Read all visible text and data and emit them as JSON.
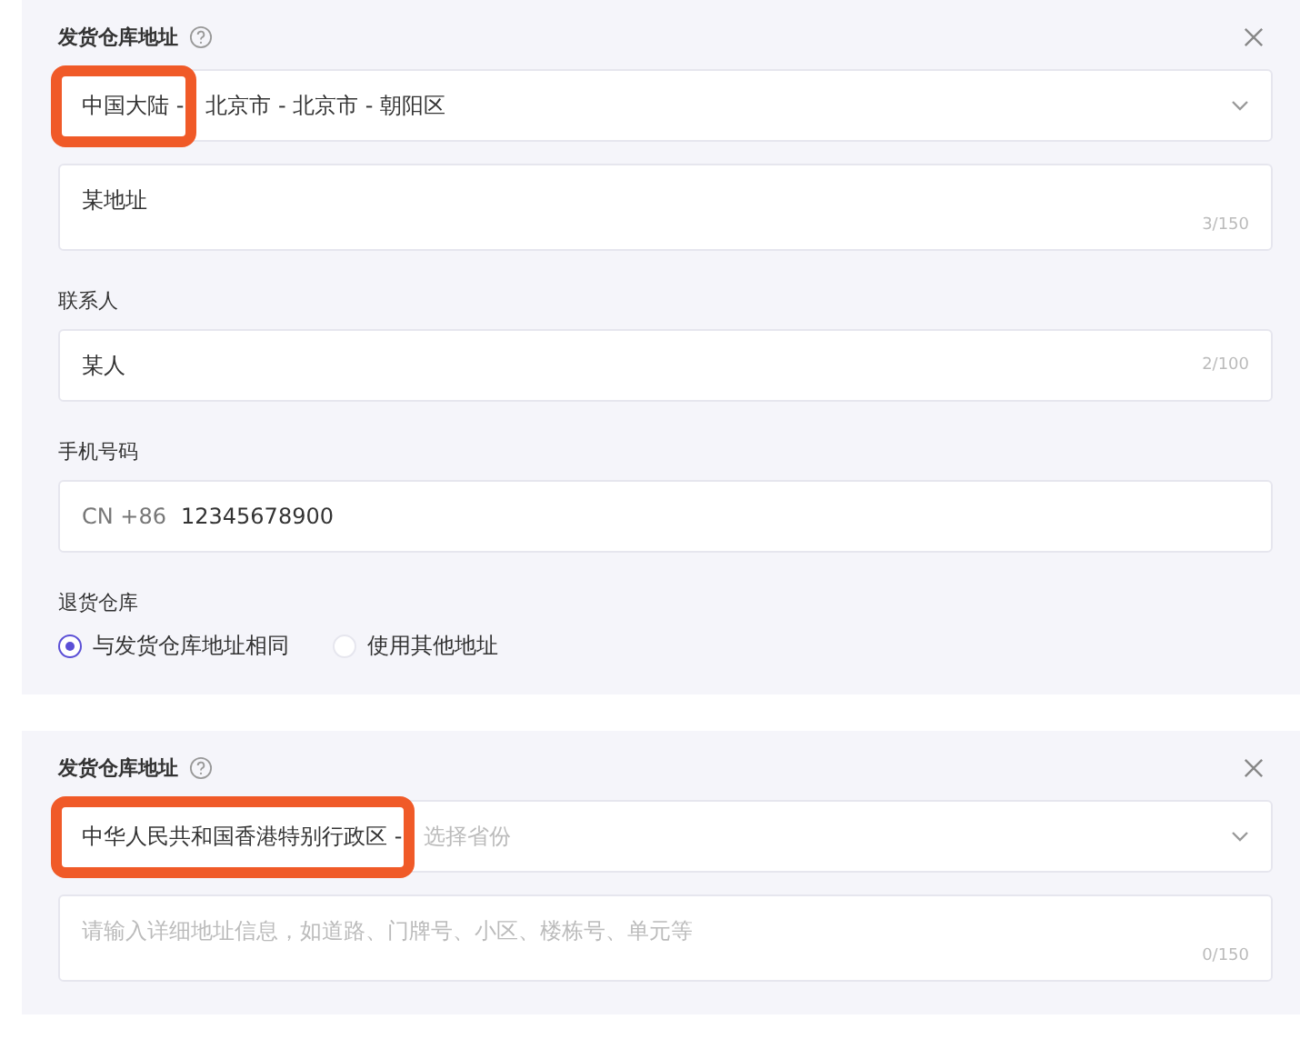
{
  "cards": [
    {
      "title": "发货仓库地址",
      "region": {
        "parts": [
          {
            "text": "中国大陆 -",
            "highlighted": true
          },
          {
            "text": "北京市 - 北京市 - 朝阳区",
            "highlighted": false
          }
        ]
      },
      "address": {
        "value": "某地址",
        "count": "3/150"
      },
      "contact": {
        "label": "联系人",
        "value": "某人",
        "count": "2/100"
      },
      "phone": {
        "label": "手机号码",
        "prefix": "CN +86",
        "value": "12345678900"
      },
      "return": {
        "label": "退货仓库",
        "options": [
          {
            "label": "与发货仓库地址相同",
            "selected": true
          },
          {
            "label": "使用其他地址",
            "selected": false
          }
        ]
      }
    },
    {
      "title": "发货仓库地址",
      "region": {
        "parts": [
          {
            "text": "中华人民共和国香港特别行政区 -",
            "highlighted": true
          }
        ],
        "placeholder": "选择省份"
      },
      "address": {
        "placeholder": "请输入详细地址信息，如道路、门牌号、小区、楼栋号、单元等",
        "count": "0/150"
      }
    }
  ]
}
